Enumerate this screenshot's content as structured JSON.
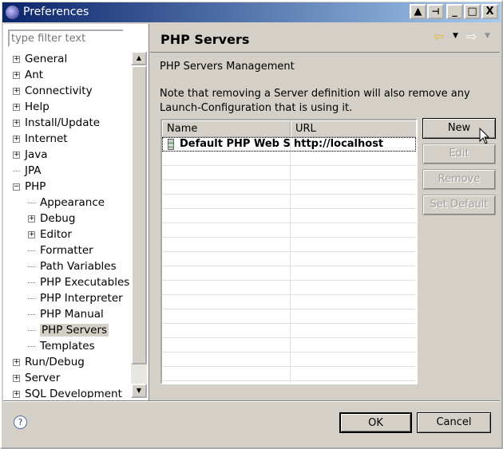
{
  "window": {
    "title": "Preferences"
  },
  "filter": {
    "placeholder": "type filter text"
  },
  "tree": [
    {
      "label": "General",
      "level": 0,
      "expander": "+"
    },
    {
      "label": "Ant",
      "level": 0,
      "expander": "+"
    },
    {
      "label": "Connectivity",
      "level": 0,
      "expander": "+"
    },
    {
      "label": "Help",
      "level": 0,
      "expander": "+"
    },
    {
      "label": "Install/Update",
      "level": 0,
      "expander": "+"
    },
    {
      "label": "Internet",
      "level": 0,
      "expander": "+"
    },
    {
      "label": "Java",
      "level": 0,
      "expander": "+"
    },
    {
      "label": "JPA",
      "level": 0,
      "expander": ""
    },
    {
      "label": "PHP",
      "level": 0,
      "expander": "-"
    },
    {
      "label": "Appearance",
      "level": 1,
      "expander": ""
    },
    {
      "label": "Debug",
      "level": 1,
      "expander": "+"
    },
    {
      "label": "Editor",
      "level": 1,
      "expander": "+"
    },
    {
      "label": "Formatter",
      "level": 1,
      "expander": ""
    },
    {
      "label": "Path Variables",
      "level": 1,
      "expander": ""
    },
    {
      "label": "PHP Executables",
      "level": 1,
      "expander": ""
    },
    {
      "label": "PHP Interpreter",
      "level": 1,
      "expander": ""
    },
    {
      "label": "PHP Manual",
      "level": 1,
      "expander": ""
    },
    {
      "label": "PHP Servers",
      "level": 1,
      "expander": "",
      "selected": true
    },
    {
      "label": "Templates",
      "level": 1,
      "expander": ""
    },
    {
      "label": "Run/Debug",
      "level": 0,
      "expander": "+"
    },
    {
      "label": "Server",
      "level": 0,
      "expander": "+"
    },
    {
      "label": "SQL Development",
      "level": 0,
      "expander": "+"
    }
  ],
  "page": {
    "title": "PHP Servers",
    "subtitle": "PHP Servers Management",
    "note": "Note that removing a Server definition will also remove any Launch-Configuration that is using it.",
    "columns": [
      "Name",
      "URL"
    ],
    "rows": [
      {
        "name": "Default PHP Web S...",
        "url": "http://localhost",
        "icon": "server-icon"
      }
    ],
    "buttons": {
      "new": "New",
      "edit": "Edit",
      "remove": "Remove",
      "set_default": "Set Default"
    }
  },
  "footer": {
    "ok": "OK",
    "cancel": "Cancel"
  },
  "colors": {
    "title_start": "#0a246a",
    "title_end": "#a6caf0",
    "face": "#d4d0c8",
    "back_arrow": "#f0c040"
  }
}
